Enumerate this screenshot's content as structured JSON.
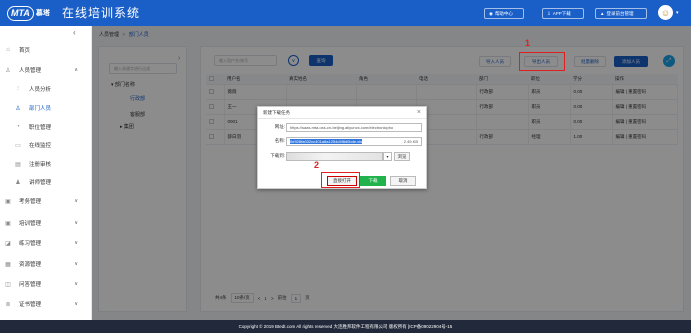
{
  "header": {
    "logo_text": "MTA",
    "logo_cn": "慕塔",
    "title": "在线培训系统",
    "buttons": [
      {
        "label": "帮助中心"
      },
      {
        "label": "APP下载"
      },
      {
        "label": "登录前台管理"
      }
    ]
  },
  "sidebar": {
    "items": [
      {
        "label": "首页",
        "icon": "home-icon"
      },
      {
        "label": "人员管理",
        "icon": "user-icon",
        "arrow": "∧"
      },
      {
        "label": "人员分析",
        "icon": "chart-icon"
      },
      {
        "label": "部门人员",
        "icon": "dept-icon"
      },
      {
        "label": "职位管理",
        "icon": "position-icon"
      },
      {
        "label": "在线监控",
        "icon": "monitor-icon"
      },
      {
        "label": "注册审核",
        "icon": "audit-icon"
      },
      {
        "label": "讲师管理",
        "icon": "teacher-icon"
      },
      {
        "label": "考务管理",
        "icon": "exam-icon",
        "arrow": "∨"
      },
      {
        "label": "培训管理",
        "icon": "training-icon",
        "arrow": "∨"
      },
      {
        "label": "练习管理",
        "icon": "practice-icon",
        "arrow": "∨"
      },
      {
        "label": "资源管理",
        "icon": "resource-icon",
        "arrow": "∨"
      },
      {
        "label": "问答管理",
        "icon": "qa-icon",
        "arrow": "∨"
      },
      {
        "label": "证书管理",
        "icon": "cert-icon",
        "arrow": "∨"
      }
    ]
  },
  "breadcrumb": {
    "parent": "人员管理",
    "sep": ">",
    "current": "部门人员"
  },
  "tree": {
    "search_placeholder": "输入关键字进行过滤",
    "root": "部门名称",
    "children": [
      "行政部",
      "客服部",
      "集团"
    ]
  },
  "toolbar": {
    "search_placeholder": "输入用户名/账号",
    "query": "查询",
    "import": "导入人员",
    "export": "导出人员",
    "batch_delete": "批量删除",
    "add": "添加人员"
  },
  "table": {
    "headers": [
      "用户名",
      "真实姓名",
      "角色",
      "电话",
      "部门",
      "职位",
      "学分",
      "操作"
    ],
    "rows": [
      {
        "username": "薇薇",
        "realname": "",
        "role": "",
        "phone": "",
        "dept": "行政部",
        "position": "职员",
        "credit": "0.00",
        "ops": "编辑 | 重置密码"
      },
      {
        "username": "王一",
        "realname": "",
        "role": "",
        "phone": "",
        "dept": "行政部",
        "position": "职员",
        "credit": "0.00",
        "ops": "编辑 | 重置密码"
      },
      {
        "username": "0001",
        "realname": "",
        "role": "",
        "phone": "",
        "dept": "",
        "position": "职员",
        "credit": "0.00",
        "ops": "编辑 | 重置密码"
      },
      {
        "username": "薛白羽",
        "realname": "",
        "role": "",
        "phone": "",
        "dept": "行政部",
        "position": "经理",
        "credit": "1.00",
        "ops": "编辑 | 重置密码"
      }
    ]
  },
  "pager": {
    "total": "共4条",
    "per_page": "10条/页",
    "prev": "<",
    "page": "1",
    "next": ">",
    "goto_label": "前往",
    "goto_value": "1",
    "goto_unit": "页"
  },
  "dialog": {
    "title": "新建下载任务",
    "url_label": "网址:",
    "url": "https://saas.mta.oss-cn-beijing.aliyuncs.com/electronicpho",
    "name_label": "名称:",
    "name": "0e928fa032cc401a8a1254c5f8d0bde.xls",
    "size": "2.45 KB",
    "dir_label": "下载到:",
    "browse": "浏览",
    "open": "直接打开",
    "download": "下载",
    "cancel": "取消"
  },
  "annotations": {
    "one": "1",
    "two": "2"
  },
  "footer": {
    "text": "Copyright © 2019 Btedt.com All rights reserved 大连胜邦软件工程有限公司 版权所有 [ICP备09022904号-15"
  }
}
